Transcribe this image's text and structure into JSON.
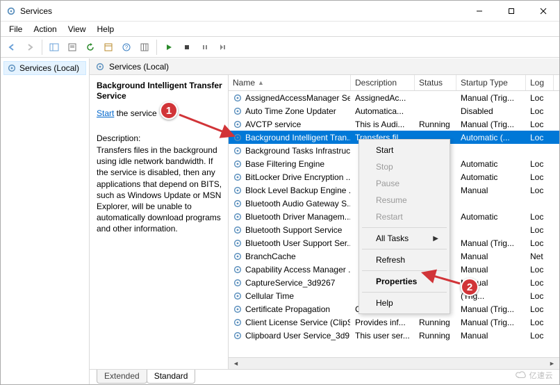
{
  "window": {
    "title": "Services",
    "menus": [
      "File",
      "Action",
      "View",
      "Help"
    ],
    "sys_controls": {
      "min": "min",
      "max": "max",
      "close": "close"
    }
  },
  "toolbar_icons": [
    "back-icon",
    "forward-icon",
    "sep",
    "show-hide-tree-icon",
    "export-list-icon",
    "refresh-icon",
    "properties-icon",
    "help-icon",
    "sep",
    "play-icon",
    "stop-icon",
    "pause-icon",
    "restart-icon"
  ],
  "tree": {
    "root_label": "Services (Local)"
  },
  "right_header": {
    "label": "Services (Local)"
  },
  "detail": {
    "title": "Background Intelligent Transfer Service",
    "action_prefix": "Start",
    "action_suffix": " the service",
    "desc_label": "Description:",
    "desc": "Transfers files in the background using idle network bandwidth. If the service is disabled, then any applications that depend on BITS, such as Windows Update or MSN Explorer, will be unable to automatically download programs and other information."
  },
  "columns": [
    "Name",
    "Description",
    "Status",
    "Startup Type",
    "Log"
  ],
  "rows": [
    {
      "name": "AssignedAccessManager Se...",
      "desc": "AssignedAc...",
      "status": "",
      "startup": "Manual (Trig...",
      "log": "Loc"
    },
    {
      "name": "Auto Time Zone Updater",
      "desc": "Automatica...",
      "status": "",
      "startup": "Disabled",
      "log": "Loc"
    },
    {
      "name": "AVCTP service",
      "desc": "This is Audi...",
      "status": "Running",
      "startup": "Manual (Trig...",
      "log": "Loc"
    },
    {
      "name": "Background Intelligent Tran...",
      "desc": "Transfers fil...",
      "status": "",
      "startup": "Automatic (...",
      "log": "Loc",
      "selected": true
    },
    {
      "name": "Background Tasks Infrastruc...",
      "desc": "",
      "status": "",
      "startup": "",
      "log": ""
    },
    {
      "name": "Base Filtering Engine",
      "desc": "",
      "status": "",
      "startup": "Automatic",
      "log": "Loc"
    },
    {
      "name": "BitLocker Drive Encryption ...",
      "desc": "",
      "status": "",
      "startup": "Automatic",
      "log": "Loc"
    },
    {
      "name": "Block Level Backup Engine ...",
      "desc": "",
      "status": "",
      "startup": "Manual",
      "log": "Loc"
    },
    {
      "name": "Bluetooth Audio Gateway S...",
      "desc": "",
      "status": "",
      "startup": "",
      "log": ""
    },
    {
      "name": "Bluetooth Driver Managem...",
      "desc": "",
      "status": "",
      "startup": "Automatic",
      "log": "Loc"
    },
    {
      "name": "Bluetooth Support Service",
      "desc": "",
      "status": "",
      "startup": "",
      "log": "Loc"
    },
    {
      "name": "Bluetooth User Support Ser...",
      "desc": "",
      "status": "",
      "startup": "Manual (Trig...",
      "log": "Loc"
    },
    {
      "name": "BranchCache",
      "desc": "",
      "status": "",
      "startup": "Manual",
      "log": "Net"
    },
    {
      "name": "Capability Access Manager ...",
      "desc": "",
      "status": "",
      "startup": "Manual",
      "log": "Loc"
    },
    {
      "name": "CaptureService_3d9267",
      "desc": "",
      "status": "",
      "startup": "Manual",
      "log": "Loc"
    },
    {
      "name": "Cellular Time",
      "desc": "",
      "status": "",
      "startup": "(Trig...",
      "log": "Loc"
    },
    {
      "name": "Certificate Propagation",
      "desc": "Copies user ...",
      "status": "",
      "startup": "Manual (Trig...",
      "log": "Loc"
    },
    {
      "name": "Client License Service (ClipS...",
      "desc": "Provides inf...",
      "status": "Running",
      "startup": "Manual (Trig...",
      "log": "Loc"
    },
    {
      "name": "Clipboard User Service_3d9...",
      "desc": "This user ser...",
      "status": "Running",
      "startup": "Manual",
      "log": "Loc"
    }
  ],
  "context_menu": [
    {
      "label": "Start",
      "enabled": true
    },
    {
      "label": "Stop",
      "enabled": false
    },
    {
      "label": "Pause",
      "enabled": false
    },
    {
      "label": "Resume",
      "enabled": false
    },
    {
      "label": "Restart",
      "enabled": false
    },
    {
      "sep": true
    },
    {
      "label": "All Tasks",
      "enabled": true,
      "submenu": true
    },
    {
      "sep": true
    },
    {
      "label": "Refresh",
      "enabled": true
    },
    {
      "sep": true
    },
    {
      "label": "Properties",
      "enabled": true,
      "strong": true
    },
    {
      "sep": true
    },
    {
      "label": "Help",
      "enabled": true
    }
  ],
  "tabs": {
    "extended": "Extended",
    "standard": "Standard"
  },
  "annotations": {
    "badge1": "1",
    "badge2": "2"
  },
  "watermark": "亿速云"
}
